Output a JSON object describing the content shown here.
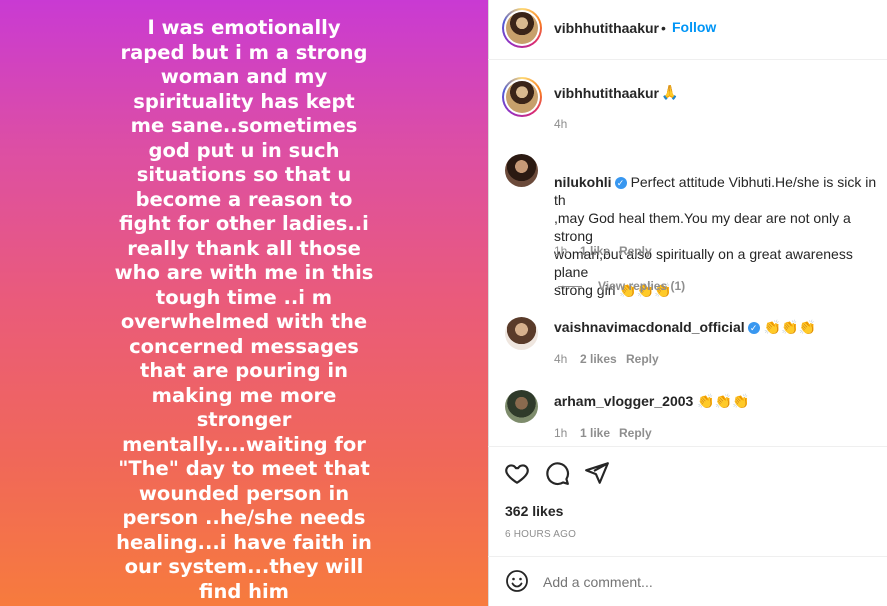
{
  "story": {
    "text": "I was emotionally\nraped but i m a strong\nwoman and my\nspirituality has kept\nme sane..sometimes\ngod put u in such\nsituations so that u\nbecome a reason to\nfight for other ladies..i\nreally thank all those\nwho are with me in this\ntough time ..i m\noverwhelmed with the\nconcerned messages\nthat are pouring in\nmaking me more\nstronger\nmentally....waiting for\n\"The\" day to meet that\nwounded person in\nperson ..he/she needs\nhealing...i have faith in\nour system...they will\nfind him"
  },
  "header": {
    "username": "vibhhutithaakur",
    "separator": "•",
    "follow_label": "Follow"
  },
  "caption": {
    "username": "vibhhutithaakur",
    "emoji": "🙏",
    "time": "4h"
  },
  "comments": [
    {
      "username": "nilukohli",
      "verified": true,
      "text": "Perfect attitude Vibhuti.He/she is sick in th\n,may God heal them.You my dear are not only a strong\nwoman,but also spiritually on a great awareness plane\nstrong girl 👏👏👏",
      "time": "1h",
      "likes": "1 like",
      "reply_label": "Reply",
      "view_replies": "View replies (1)"
    },
    {
      "username": "vaishnavimacdonald_official",
      "verified": true,
      "text": "👏👏👏",
      "time": "4h",
      "likes": "2 likes",
      "reply_label": "Reply"
    },
    {
      "username": "arham_vlogger_2003",
      "verified": false,
      "text": "👏👏👏",
      "time": "1h",
      "likes": "1 like",
      "reply_label": "Reply"
    }
  ],
  "actions": {
    "like_icon": "heart-icon",
    "comment_icon": "comment-icon",
    "share_icon": "share-icon"
  },
  "stats": {
    "likes": "362 likes",
    "time_ago": "6 HOURS AGO"
  },
  "add_comment": {
    "emoji_icon": "smiley-icon",
    "placeholder": "Add a comment..."
  },
  "colors": {
    "accent": "#0095f6",
    "gradient_top": "#c93ad3",
    "gradient_bottom": "#f77b3d"
  }
}
